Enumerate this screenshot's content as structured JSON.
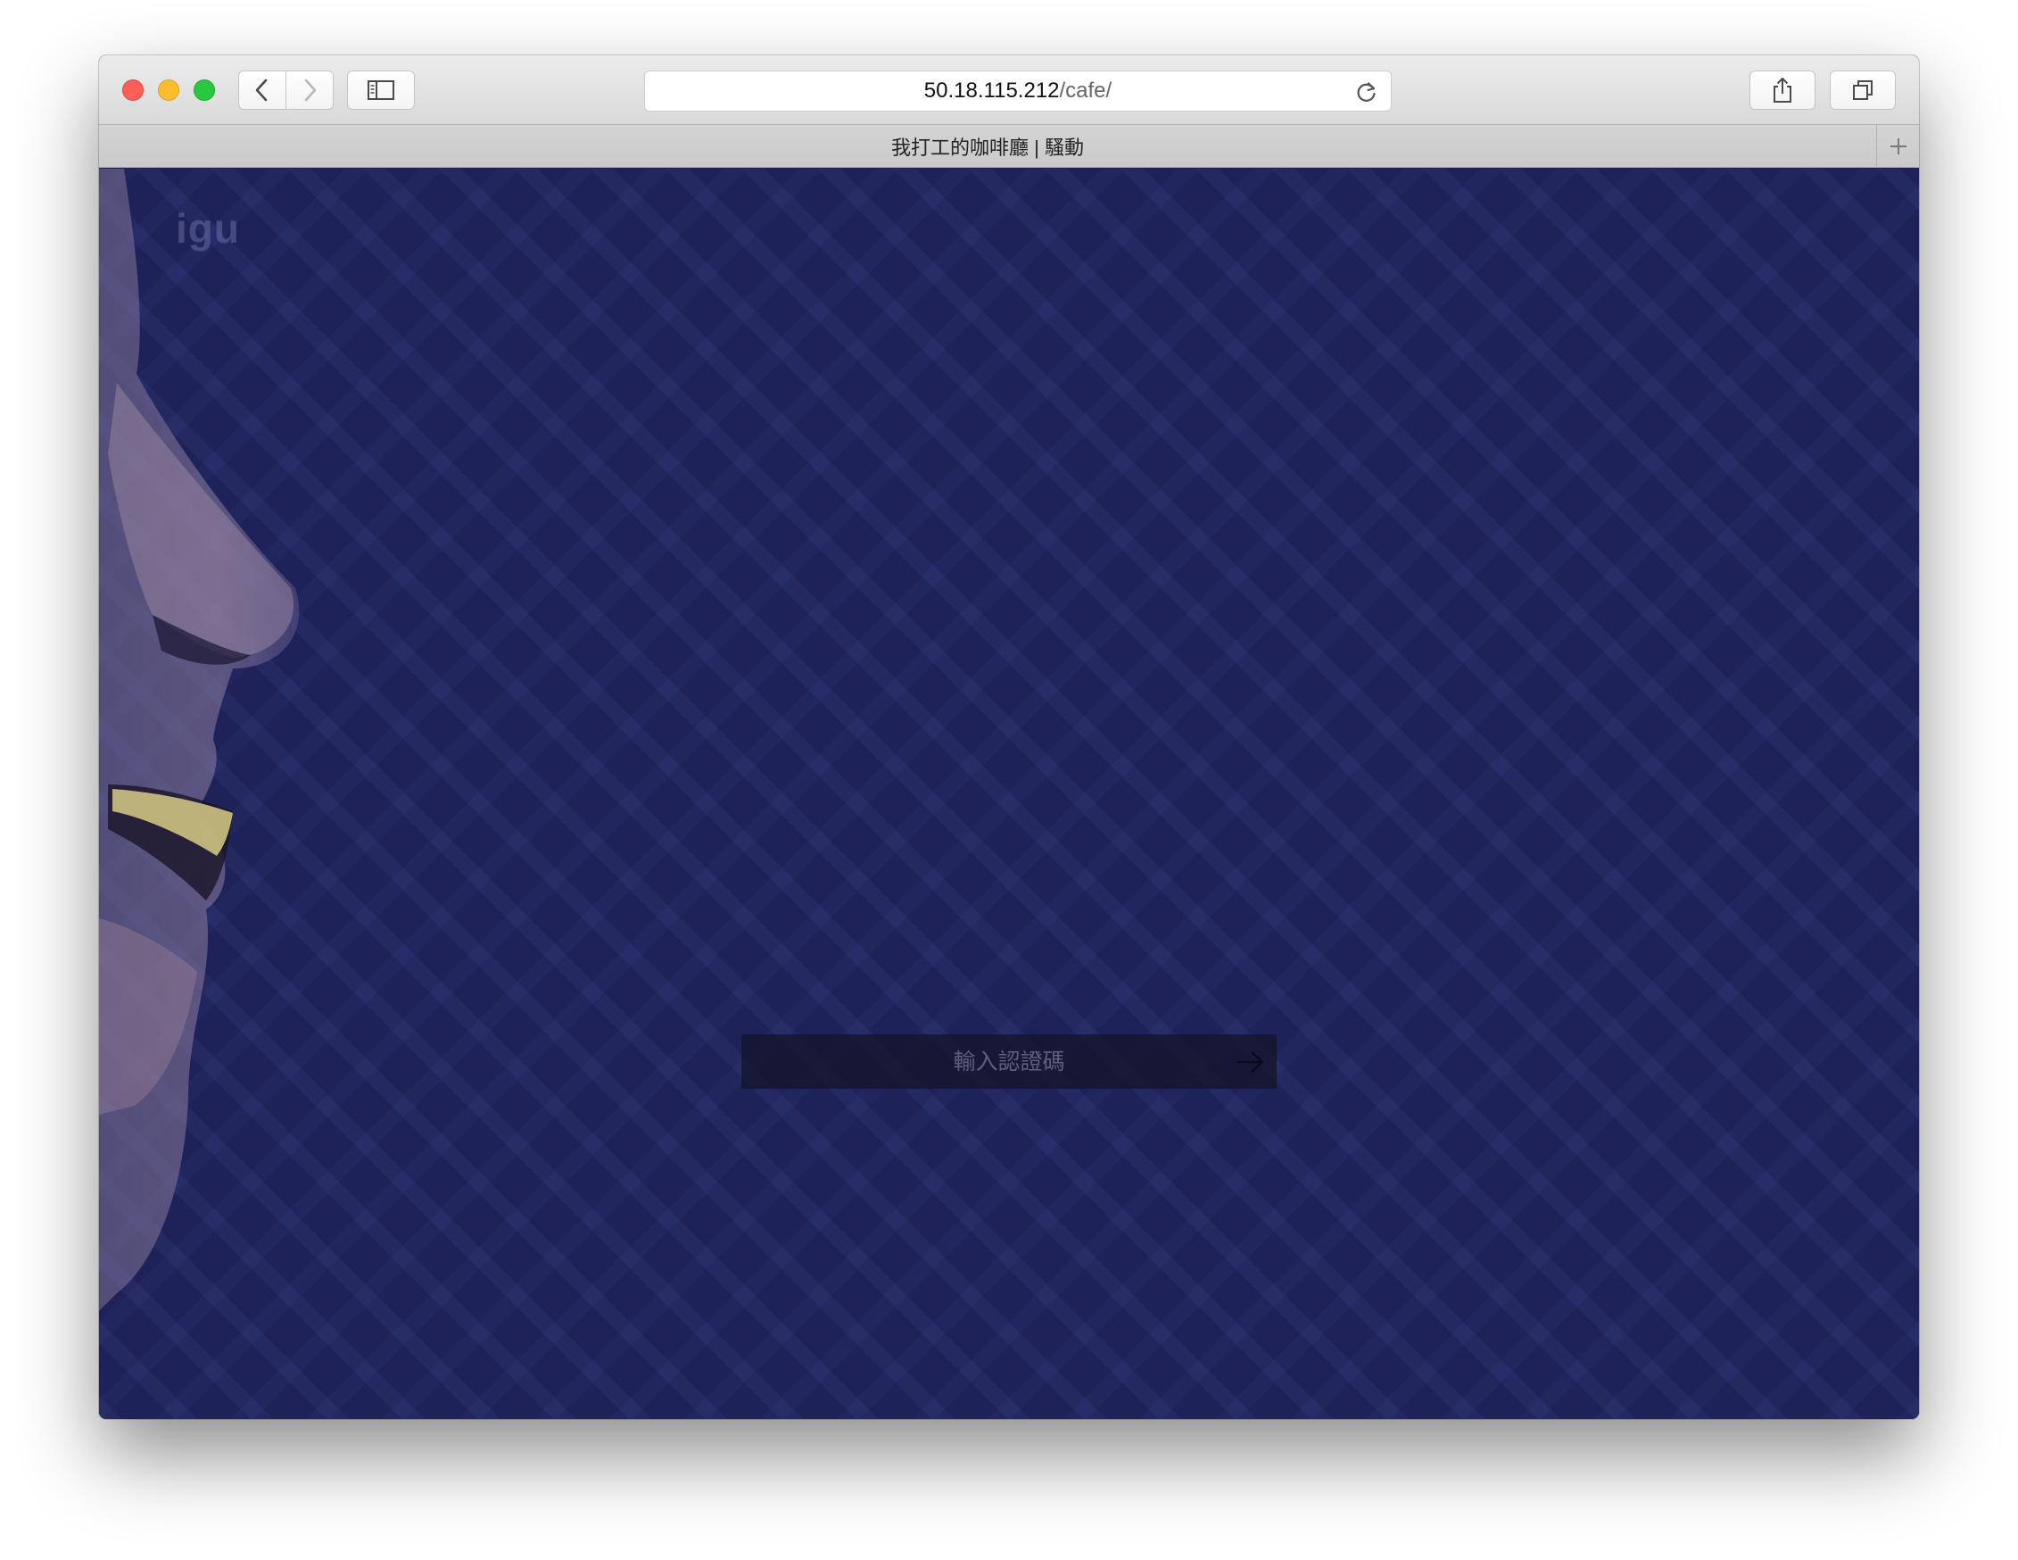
{
  "browser": {
    "url_host": "50.18.115.212",
    "url_path": "/cafe/",
    "tab_title": "我打工的咖啡廳 | 騷動"
  },
  "page": {
    "logo_text": "igu",
    "auth_placeholder": "輸入認證碼"
  },
  "colors": {
    "background": "#1f2258",
    "pattern": "#3c4e96",
    "auth_box": "#14142c"
  },
  "icons": {
    "back": "chevron-left-icon",
    "forward": "chevron-right-icon",
    "sidebar": "sidebar-icon",
    "reload": "reload-icon",
    "share": "share-icon",
    "tabs": "tabs-overview-icon",
    "new_tab": "plus-icon",
    "submit": "arrow-right-icon"
  }
}
